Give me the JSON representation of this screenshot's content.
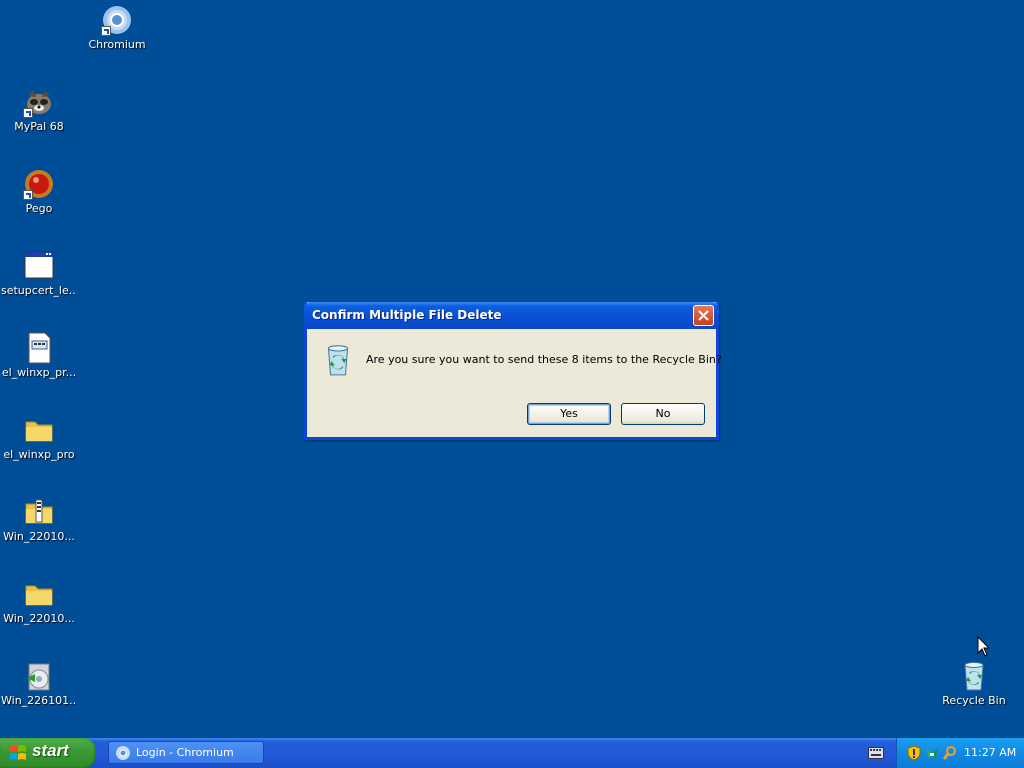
{
  "desktop": {
    "icons": [
      {
        "label": "Chromium",
        "icon": "chromium-icon"
      },
      {
        "label": "MyPal 68",
        "icon": "mypal-icon"
      },
      {
        "label": "Pego",
        "icon": "pego-icon"
      },
      {
        "label": "setupcert_le...",
        "icon": "window-app-icon"
      },
      {
        "label": "el_winxp_pr...",
        "icon": "document-icon"
      },
      {
        "label": "el_winxp_pro",
        "icon": "folder-icon"
      },
      {
        "label": "Win_22010...",
        "icon": "zip-folder-icon"
      },
      {
        "label": "Win_22010...",
        "icon": "folder-icon"
      },
      {
        "label": "Win_226101...",
        "icon": "disc-installer-icon"
      },
      {
        "label": "Recycle Bin",
        "icon": "recycle-bin-icon"
      }
    ]
  },
  "dialog": {
    "title": "Confirm Multiple File Delete",
    "message": "Are you sure you want to send these 8 items to the Recycle Bin?",
    "yes_label": "Yes",
    "no_label": "No"
  },
  "taskbar": {
    "start_label": "start",
    "tasks": [
      {
        "label": "Login - Chromium"
      }
    ],
    "clock": "11:27 AM"
  },
  "colors": {
    "desktop": "#004e98",
    "titlebar": "#0a4fd0",
    "dialog_bg": "#ece9d8",
    "start_green": "#3c9a35",
    "tray_blue": "#0f8ae5"
  }
}
